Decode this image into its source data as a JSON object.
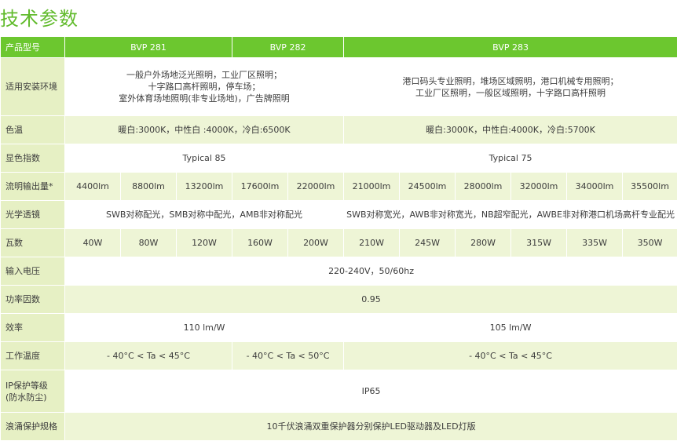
{
  "title": "技术参数",
  "header": {
    "label": "产品型号",
    "models": [
      "BVP 281",
      "BVP 282",
      "BVP 283"
    ]
  },
  "rows": {
    "env": {
      "label": "适用安装环境",
      "a_lines": [
        "一般户外场地泛光照明，工业厂区照明；",
        "十字路口高杆照明，停车场；",
        "室外体育场地照明(非专业场地)，广告牌照明"
      ],
      "b_lines": [
        "港口码头专业照明，堆场区域照明，港口机械专用照明；",
        "工业厂区照明，一般区域照明，十字路口高杆照明"
      ]
    },
    "cct": {
      "label": "色温",
      "a": "暖白:3000K，中性白 :4000K，冷白:6500K",
      "b": "暖白:3000K，中性白:4000K，冷白:5700K"
    },
    "cri": {
      "label": "显色指数",
      "a": "Typical 85",
      "b": "Typical 75"
    },
    "flux": {
      "label": "流明输出量*",
      "values": [
        "4400lm",
        "8800lm",
        "13200lm",
        "17600lm",
        "22000lm",
        "21000lm",
        "24500lm",
        "28000lm",
        "32000lm",
        "34000lm",
        "35500lm"
      ]
    },
    "optics": {
      "label": "光学透镜",
      "a": "SWB对称配光，SMB对称中配光，AMB非对称配光",
      "b": "SWB对称宽光，AWB非对称宽光，NB超窄配光，AWBE非对称港口机场高杆专业配光"
    },
    "watt": {
      "label": "瓦数",
      "values": [
        "40W",
        "80W",
        "120W",
        "160W",
        "200W",
        "210W",
        "245W",
        "280W",
        "315W",
        "335W",
        "350W"
      ]
    },
    "voltage": {
      "label": "输入电压",
      "value": "220-240V，50/60hz"
    },
    "pf": {
      "label": "功率因数",
      "value": "0.95"
    },
    "eff": {
      "label": "效率",
      "a": "110 lm/W",
      "b": "105 lm/W"
    },
    "temp": {
      "label": "工作温度",
      "a": "- 40°C < Ta < 45°C",
      "b": "- 40°C < Ta < 50°C",
      "c": "- 40°C < Ta < 45°C"
    },
    "ip": {
      "label_lines": [
        "IP保护等级",
        "(防水防尘)"
      ],
      "value": "IP65"
    },
    "surge": {
      "label": "浪涌保护规格",
      "value": "10千伏浪涌双重保护器分别保护LED驱动器及LED灯版"
    }
  }
}
